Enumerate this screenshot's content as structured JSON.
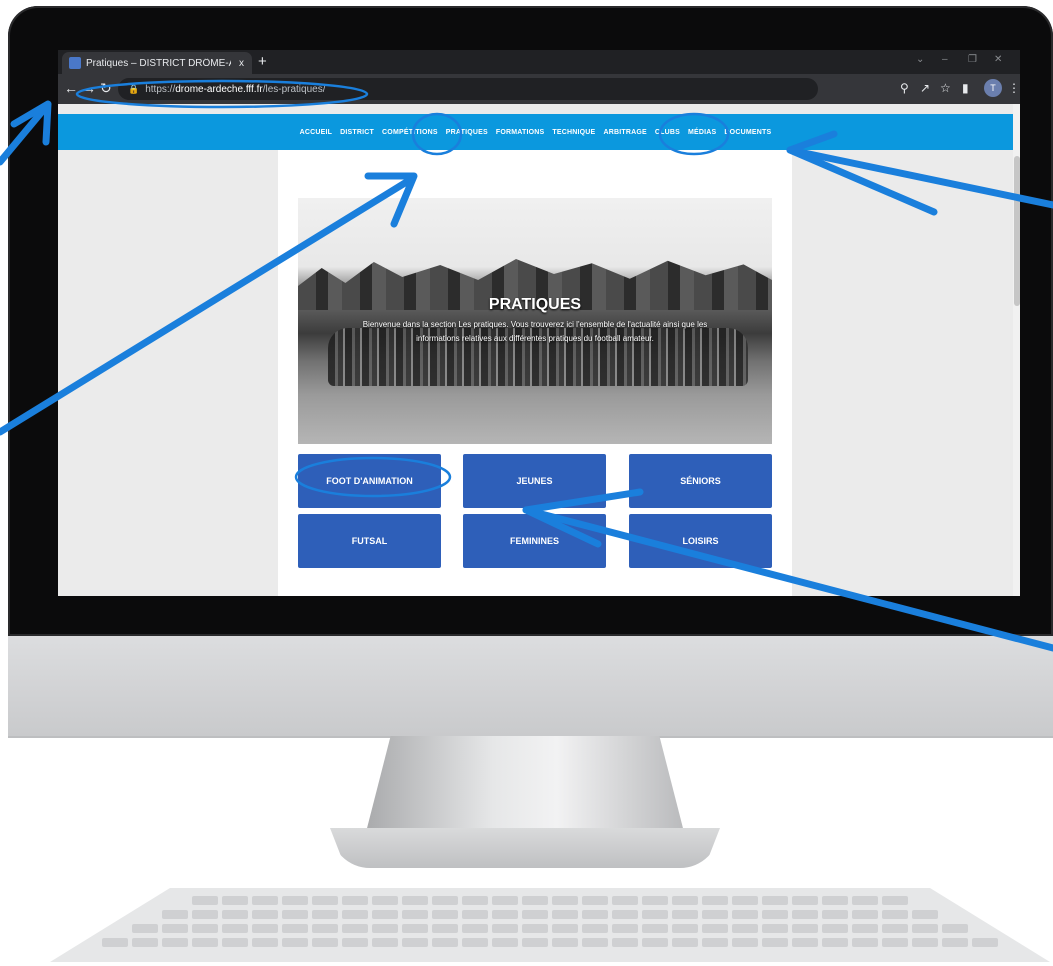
{
  "browser": {
    "tab_title": "Pratiques – DISTRICT DRÔME-AR",
    "tab_close": "x",
    "new_tab": "+",
    "url_prefix": "https://",
    "url_host": "drome-ardeche.fff.fr",
    "url_path": "/les-pratiques/",
    "avatar_letter": "T"
  },
  "site_nav": {
    "items": [
      "ACCUEIL",
      "DISTRICT",
      "COMPÉTITIONS",
      "PRATIQUES",
      "FORMATIONS",
      "TECHNIQUE",
      "ARBITRAGE",
      "CLUBS",
      "MÉDIAS",
      "DOCUMENTS"
    ]
  },
  "hero": {
    "title": "PRATIQUES",
    "text": "Bienvenue dans la section Les pratiques. Vous trouverez ici l'ensemble de l'actualité ainsi que les informations relatives aux différentes pratiques du football amateur."
  },
  "buttons": {
    "foot_animation": "FOOT D'ANIMATION",
    "jeunes": "JEUNES",
    "seniors": "SÉNIORS",
    "futsal": "FUTSAL",
    "feminines": "FEMININES",
    "loisirs": "LOISIRS"
  },
  "colors": {
    "site_nav": "#0b98de",
    "button": "#2e5fb9",
    "annotation": "#1a7fdc"
  }
}
